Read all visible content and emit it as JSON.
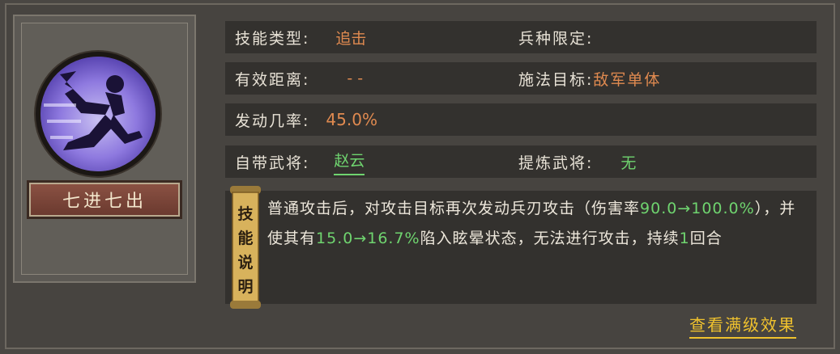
{
  "skill": {
    "name": "七进七出",
    "icon": "running-warrior-icon"
  },
  "info": {
    "type_label": "技能类型:",
    "type_value": "追击",
    "troop_label": "兵种限定:",
    "troop_value": "",
    "distance_label": "有效距离:",
    "distance_value": "--",
    "target_label": "施法目标:",
    "target_value": "敌军单体",
    "rate_label": "发动几率:",
    "rate_value": "45.0%",
    "own_general_label": "自带武将:",
    "own_general_value": "赵云",
    "extract_general_label": "提炼武将:",
    "extract_general_value": "无"
  },
  "description": {
    "scroll_label": [
      "技",
      "能",
      "说",
      "明"
    ],
    "seg1": "普通攻击后，对攻击目标再次发动兵刃攻击（伤害率",
    "seg2": "90.0→100.0%",
    "seg3": "），并使其有",
    "seg4": "15.0→16.7%",
    "seg5": "陷入眩晕状态，无法进行攻击，持续",
    "seg6": "1",
    "seg7": "回合"
  },
  "actions": {
    "full_effect_label": "查看满级效果"
  },
  "colors": {
    "orange": "#e08a50",
    "green": "#6fd46f",
    "gold": "#f0c22e"
  }
}
